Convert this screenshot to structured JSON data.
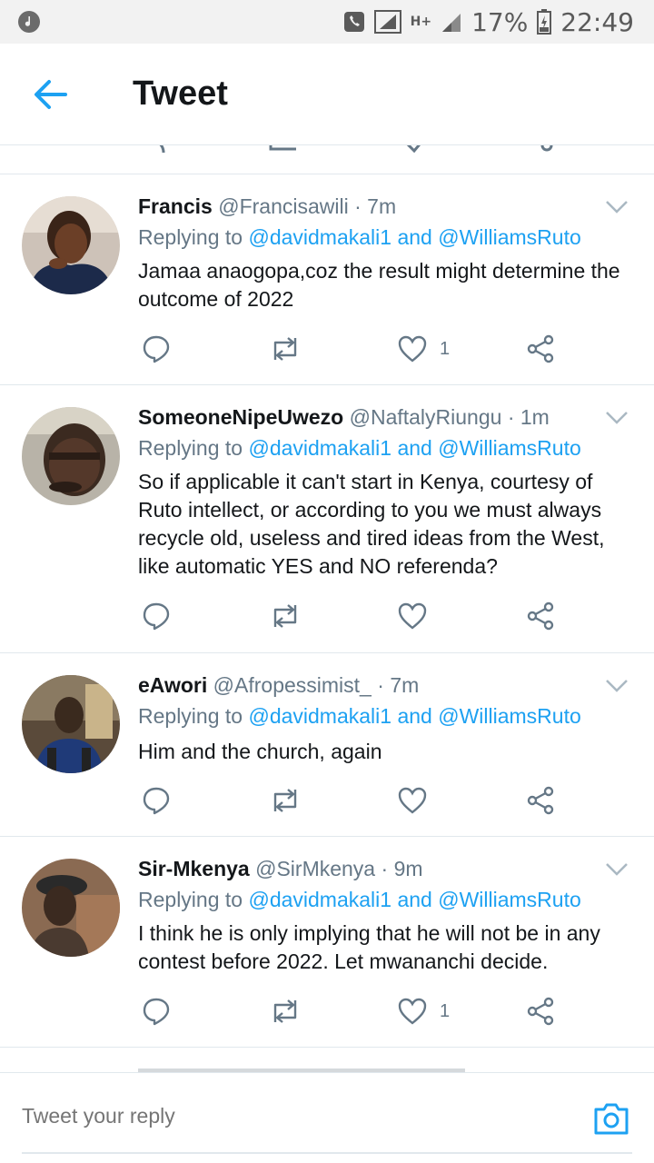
{
  "status_bar": {
    "battery_percent": "17%",
    "time": "22:49",
    "network": "H+"
  },
  "header": {
    "title": "Tweet"
  },
  "tweets": [
    {
      "name": "Francis",
      "handle": "@Francisawili",
      "time": "7m",
      "replying_prefix": "Replying to",
      "mention1": "@davidmakali1",
      "and": "and",
      "mention2": "@WilliamsRuto",
      "text": "Jamaa anaogopa,coz the result might determine the outcome of 2022",
      "like_count": "1"
    },
    {
      "name": "SomeoneNipeUwezo",
      "handle": "@NaftalyRiungu",
      "time": "1m",
      "replying_prefix": "Replying to",
      "mention1": "@davidmakali1",
      "and": "and",
      "mention2": "@WilliamsRuto",
      "text": "So if applicable it can't start in Kenya, courtesy of Ruto intellect, or according to you we must always recycle old, useless and tired ideas from the West, like automatic YES and NO referenda?",
      "like_count": ""
    },
    {
      "name": "eAwori",
      "handle": "@Afropessimist_",
      "time": "7m",
      "replying_prefix": "Replying to",
      "mention1": "@davidmakali1",
      "and": "and",
      "mention2": "@WilliamsRuto",
      "text": "Him and the church, again",
      "like_count": ""
    },
    {
      "name": "Sir-Mkenya",
      "handle": "@SirMkenya",
      "time": "9m",
      "replying_prefix": "Replying to",
      "mention1": "@davidmakali1",
      "and": "and",
      "mention2": "@WilliamsRuto",
      "text": "I think he is only implying that he will not be in any contest before 2022. Let mwananchi decide.",
      "like_count": "1"
    }
  ],
  "reply_bar": {
    "placeholder": "Tweet your reply"
  },
  "icons": {
    "back": "back-arrow-icon",
    "caret": "chevron-down-icon",
    "reply": "reply-bubble-icon",
    "retweet": "retweet-icon",
    "like": "heart-icon",
    "share": "share-icon",
    "camera": "camera-icon"
  },
  "colors": {
    "accent": "#1da1f2",
    "secondary_text": "#657786",
    "primary_text": "#14171a",
    "divider": "#e1e8ed"
  }
}
